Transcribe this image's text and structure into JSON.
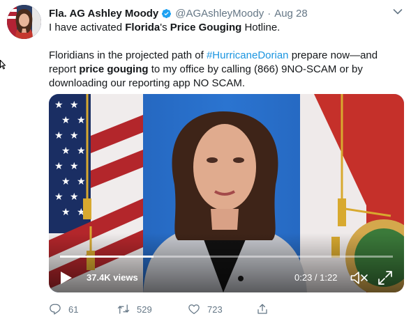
{
  "tweet": {
    "author_name": "Fla. AG Ashley Moody",
    "handle": "@AGAshleyMoody",
    "separator": "·",
    "date": "Aug 28",
    "text": {
      "line1_part1": "I have activated ",
      "line1_bold1": "Florida",
      "line1_part2": "'s ",
      "line1_bold2": "Price Gouging",
      "line1_part3": " Hotline.",
      "para2_part1": "Floridians in the projected path of ",
      "para2_hashtag": "#HurricaneDorian",
      "para2_part2": " prepare now—and report ",
      "para2_bold": "price gouging",
      "para2_part3": " to my office by calling (866) 9NO-SCAM or by downloading our reporting app NO SCAM."
    }
  },
  "video": {
    "views": "37.4K views",
    "time": "0:23 / 1:22",
    "progress": 0.28
  },
  "actions": {
    "replies": "61",
    "retweets": "529",
    "likes": "723"
  },
  "colors": {
    "link": "#1b95e0",
    "verified": "#1da1f2",
    "muted": "#657786",
    "text": "#14171a"
  },
  "icons": [
    "avatar",
    "verified-badge-icon",
    "caret-down-icon",
    "play-icon",
    "mute-icon",
    "fullscreen-icon",
    "reply-icon",
    "retweet-icon",
    "like-icon",
    "share-icon"
  ]
}
